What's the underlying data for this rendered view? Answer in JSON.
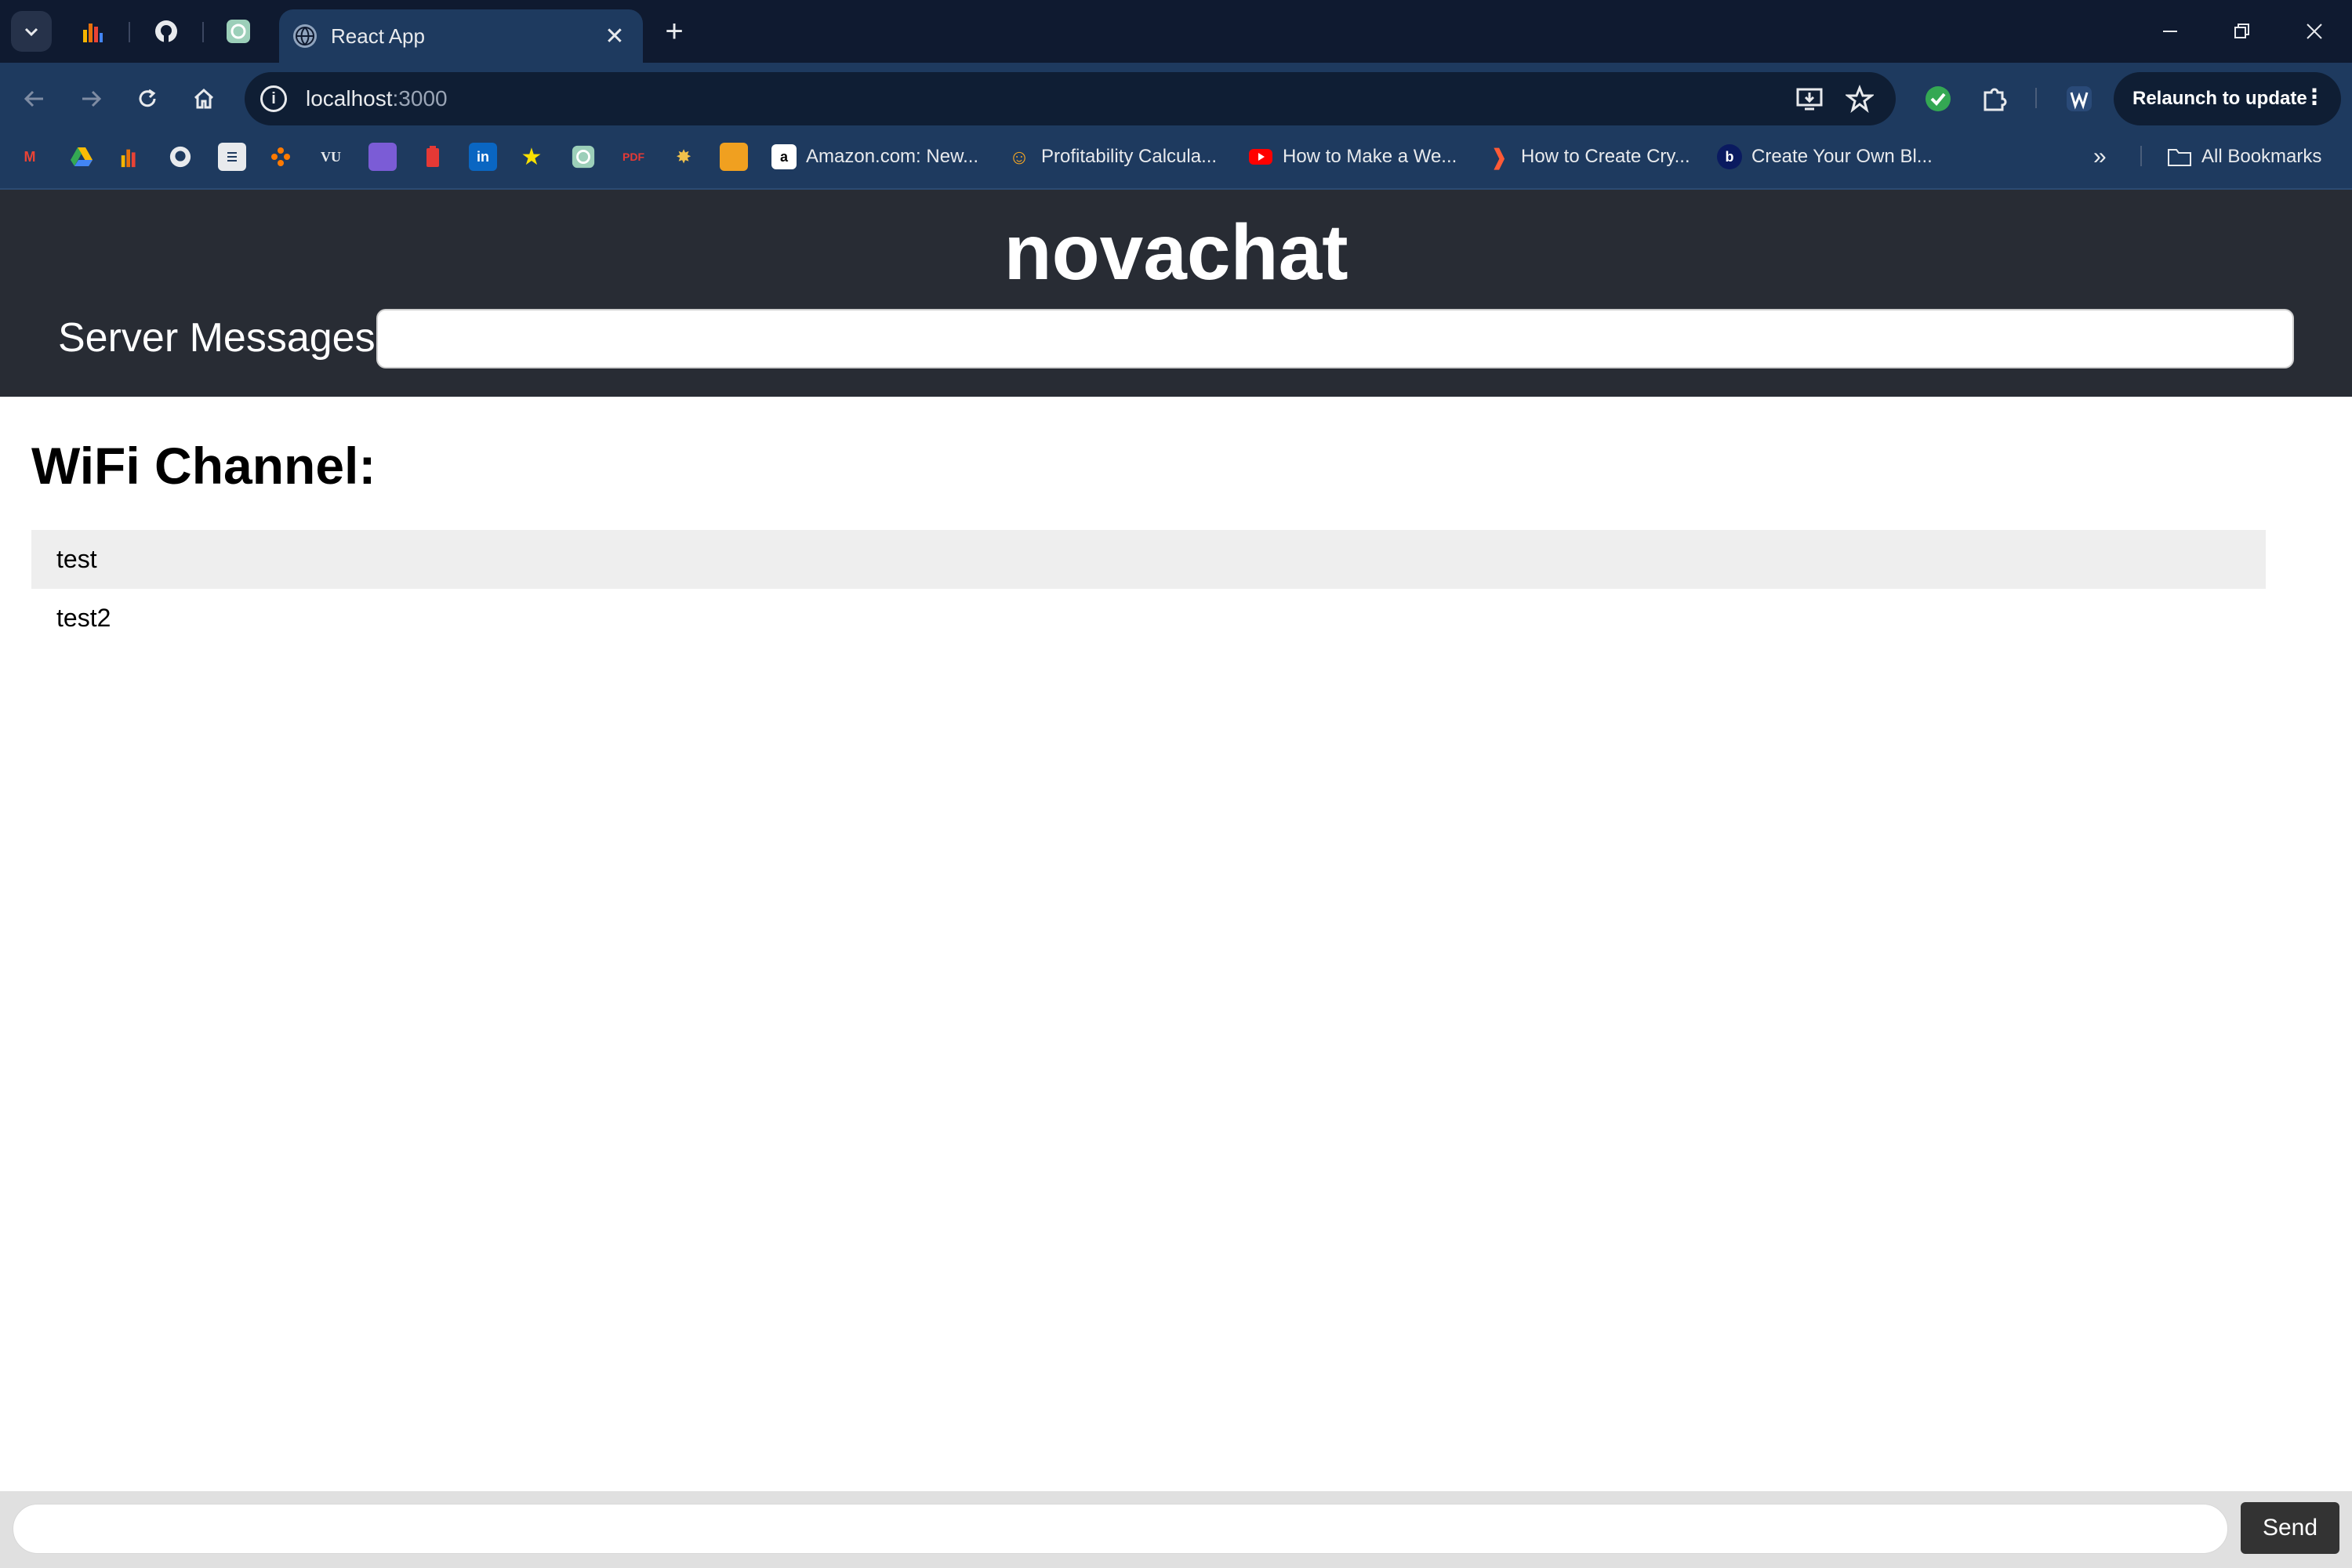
{
  "browser": {
    "active_tab_title": "React App",
    "url_host": "localhost",
    "url_port": ":3000",
    "relaunch_label": "Relaunch to update",
    "bookmarks": [
      {
        "label": "Amazon.com: New..."
      },
      {
        "label": "Profitability Calcula..."
      },
      {
        "label": "How to Make a We..."
      },
      {
        "label": "How to Create Cry..."
      },
      {
        "label": "Create Your Own Bl..."
      }
    ],
    "all_bookmarks_label": "All Bookmarks"
  },
  "app": {
    "title": "novachat",
    "server_messages_label": "Server Messages:",
    "server_messages_value": "",
    "channel_title": "WiFi Channel:",
    "messages": [
      "test",
      "test2"
    ],
    "message_input_value": "",
    "send_label": "Send"
  },
  "colors": {
    "tabstrip": "#0f1a30",
    "toolbar": "#1e3a5f",
    "app_header": "#282c34",
    "send_button": "#333333"
  }
}
